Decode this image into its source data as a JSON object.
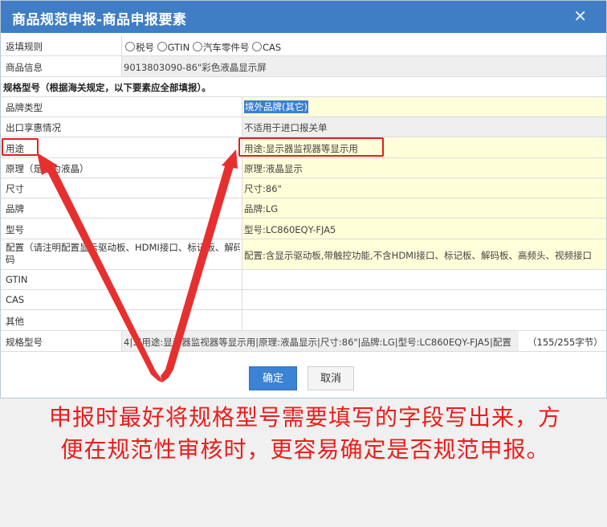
{
  "dialog": {
    "title": "商品规范申报-商品申报要素",
    "close_glyph": "✕"
  },
  "return_rule": {
    "label": "返填规则",
    "options": [
      "税号",
      "GTIN",
      "汽车零件号",
      "CAS"
    ]
  },
  "product_info": {
    "label": "商品信息",
    "value": "9013803090-86\"彩色液晶显示屏"
  },
  "section_note": "规格型号（根据海关规定，以下要素应全部填报）。",
  "fields": [
    {
      "label": "品牌类型",
      "value": "境外品牌(其它)"
    },
    {
      "label": "出口享惠情况",
      "value": "不适用于进口报关单"
    },
    {
      "label": "用途",
      "value": "用途:显示器监视器等显示用"
    },
    {
      "label": "原理（是否为液晶）",
      "value": "原理:液晶显示"
    },
    {
      "label": "尺寸",
      "value": "尺寸:86\""
    },
    {
      "label": "品牌",
      "value": "品牌:LG"
    },
    {
      "label": "型号",
      "value": "型号:LC860EQY-FJA5"
    },
    {
      "label": "配置（请注明配置显示驱动板、HDMI接口、标记板、解码",
      "value": "配置:含显示驱动板,带触控功能,不含HDMI接口、标记板、解码板、高频头、视频接口"
    },
    {
      "label": "GTIN",
      "value": ""
    },
    {
      "label": "CAS",
      "value": ""
    },
    {
      "label": "其他",
      "value": ""
    }
  ],
  "config_label_line2": "码",
  "spec": {
    "label": "规格型号",
    "value": "4|3|用途:显示器监视器等显示用|原理:液晶显示|尺寸:86\"|品牌:LG|型号:LC860EQY-FJA5|配置",
    "counter": "（155/255字节）"
  },
  "buttons": {
    "ok": "确定",
    "cancel": "取消"
  },
  "caption": {
    "line1": "申报时最好将规格型号需要填写的字段写出来，方",
    "line2": "便在规范性审核时，更容易确定是否规范申报。"
  },
  "colors": {
    "titlebar": "#3f7ec4",
    "field_highlight": "#fefed9",
    "annotation_red": "#e02020"
  }
}
